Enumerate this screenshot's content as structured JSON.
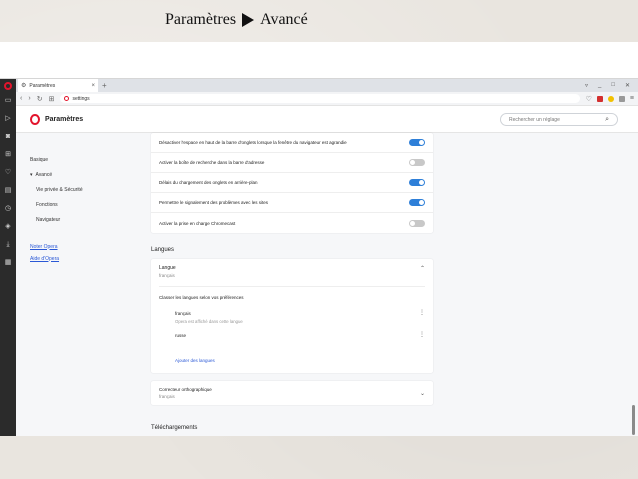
{
  "slide": {
    "title_part1": "Paramètres",
    "title_part2": "Avancé"
  },
  "tabbar": {
    "tab_label": "Paramètres",
    "close": "×",
    "new_tab": "+"
  },
  "addressbar": {
    "url": "settings"
  },
  "page": {
    "title": "Paramètres",
    "search_placeholder": "Rechercher un réglage"
  },
  "leftnav": {
    "items": [
      {
        "label": "Basique"
      },
      {
        "label": "Avancé"
      },
      {
        "label": "Vie privée & Sécurité"
      },
      {
        "label": "Fonctions"
      },
      {
        "label": "Navigateur"
      },
      {
        "label": "Noter Opera"
      },
      {
        "label": "Aide d'Opera"
      }
    ]
  },
  "toggles": [
    {
      "label": "Désactiver l'espace en haut de la barre d'onglets lorsque la fenêtre du navigateur est agrandie",
      "on": true
    },
    {
      "label": "Activer la boîte de recherche dans la barre d'adresse",
      "on": false
    },
    {
      "label": "Délais du chargement des onglets en arrière-plan",
      "on": true
    },
    {
      "label": "Permettre le signalement des problèmes avec les sites",
      "on": true
    },
    {
      "label": "Activer la prise en charge Chromecast",
      "on": false
    }
  ],
  "languages": {
    "section_title": "Langues",
    "langue_label": "Langue",
    "langue_value": "français",
    "order_label": "Classer les langues selon vos préférences",
    "items": [
      {
        "name": "français",
        "info": "Opera est affiché dans cette langue"
      },
      {
        "name": "russe",
        "info": ""
      }
    ],
    "add_label": "Ajouter des langues",
    "spell_label": "Correcteur orthographique",
    "spell_value": "français"
  },
  "downloads_title": "Téléchargements",
  "colors": {
    "opera_red": "#e3142c",
    "toggle_on": "#2e7fd8",
    "toggle_off": "#c8c8c8",
    "link": "#2a58d6"
  }
}
